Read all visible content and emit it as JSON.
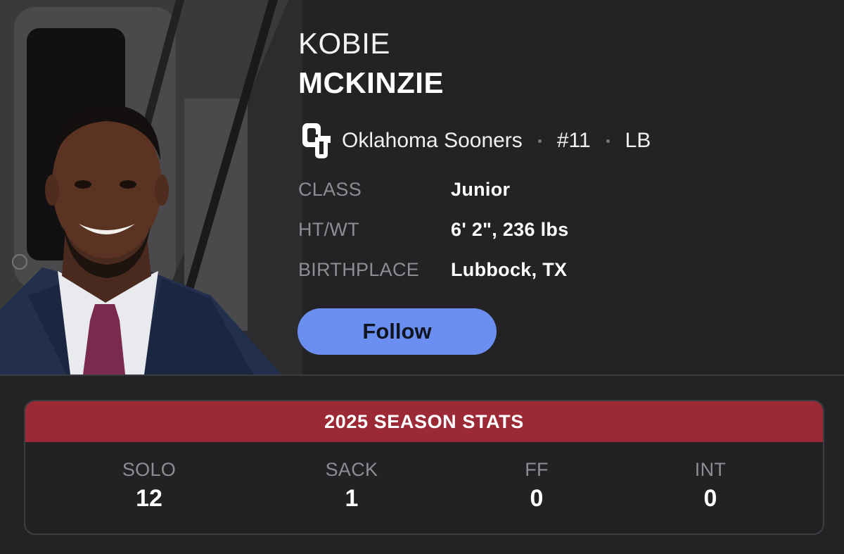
{
  "player": {
    "first_name": "KOBIE",
    "last_name": "MCKINZIE",
    "team": "Oklahoma Sooners",
    "number": "#11",
    "position": "LB",
    "team_logo_icon": "ou-logo-icon"
  },
  "info": [
    {
      "label": "CLASS",
      "value": "Junior"
    },
    {
      "label": "HT/WT",
      "value": "6' 2\", 236 lbs"
    },
    {
      "label": "BIRTHPLACE",
      "value": "Lubbock, TX"
    }
  ],
  "follow_label": "Follow",
  "stats": {
    "title": "2025 SEASON STATS",
    "items": [
      {
        "label": "SOLO",
        "value": "12"
      },
      {
        "label": "SACK",
        "value": "1"
      },
      {
        "label": "FF",
        "value": "0"
      },
      {
        "label": "INT",
        "value": "0"
      }
    ]
  },
  "colors": {
    "background": "#232326",
    "accent_crimson": "#9b2a36",
    "follow_button": "#6b8ff0"
  }
}
